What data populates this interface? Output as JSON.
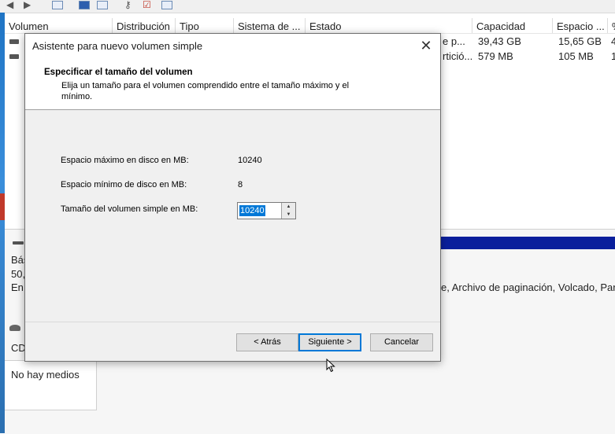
{
  "background": {
    "columns": [
      "Volumen",
      "Distribución",
      "Tipo",
      "Sistema de ...",
      "Estado",
      "Capacidad",
      "Espacio ...",
      "%"
    ],
    "rows": [
      {
        "estado": "e p...",
        "capacidad": "39,43 GB",
        "espacio": "15,65 GB",
        "pct": "4"
      },
      {
        "estado": "rtició...",
        "capacidad": "579 MB",
        "espacio": "105 MB",
        "pct": "1"
      }
    ],
    "disk0_labels": [
      "Bás",
      "50,",
      "En"
    ],
    "partition_text": "e, Archivo de paginación, Volcado, Partic",
    "cd_label": "CD",
    "no_media": "No hay medios"
  },
  "dialog": {
    "title": "Asistente para nuevo volumen simple",
    "close_glyph": "✕",
    "header_title": "Especificar el tamaño del volumen",
    "header_subtitle": "Elija un tamaño para el volumen comprendido entre el tamaño máximo y el mínimo.",
    "max_label": "Espacio máximo en disco en MB:",
    "max_value": "10240",
    "min_label": "Espacio mínimo de disco en MB:",
    "min_value": "8",
    "size_label": "Tamaño del volumen simple en MB:",
    "size_value": "10240",
    "back_label": "< Atrás",
    "next_label": "Siguiente >",
    "cancel_label": "Cancelar"
  },
  "colors": {
    "accent": "#0078d7",
    "disk_bar": "#0a1f9c"
  }
}
